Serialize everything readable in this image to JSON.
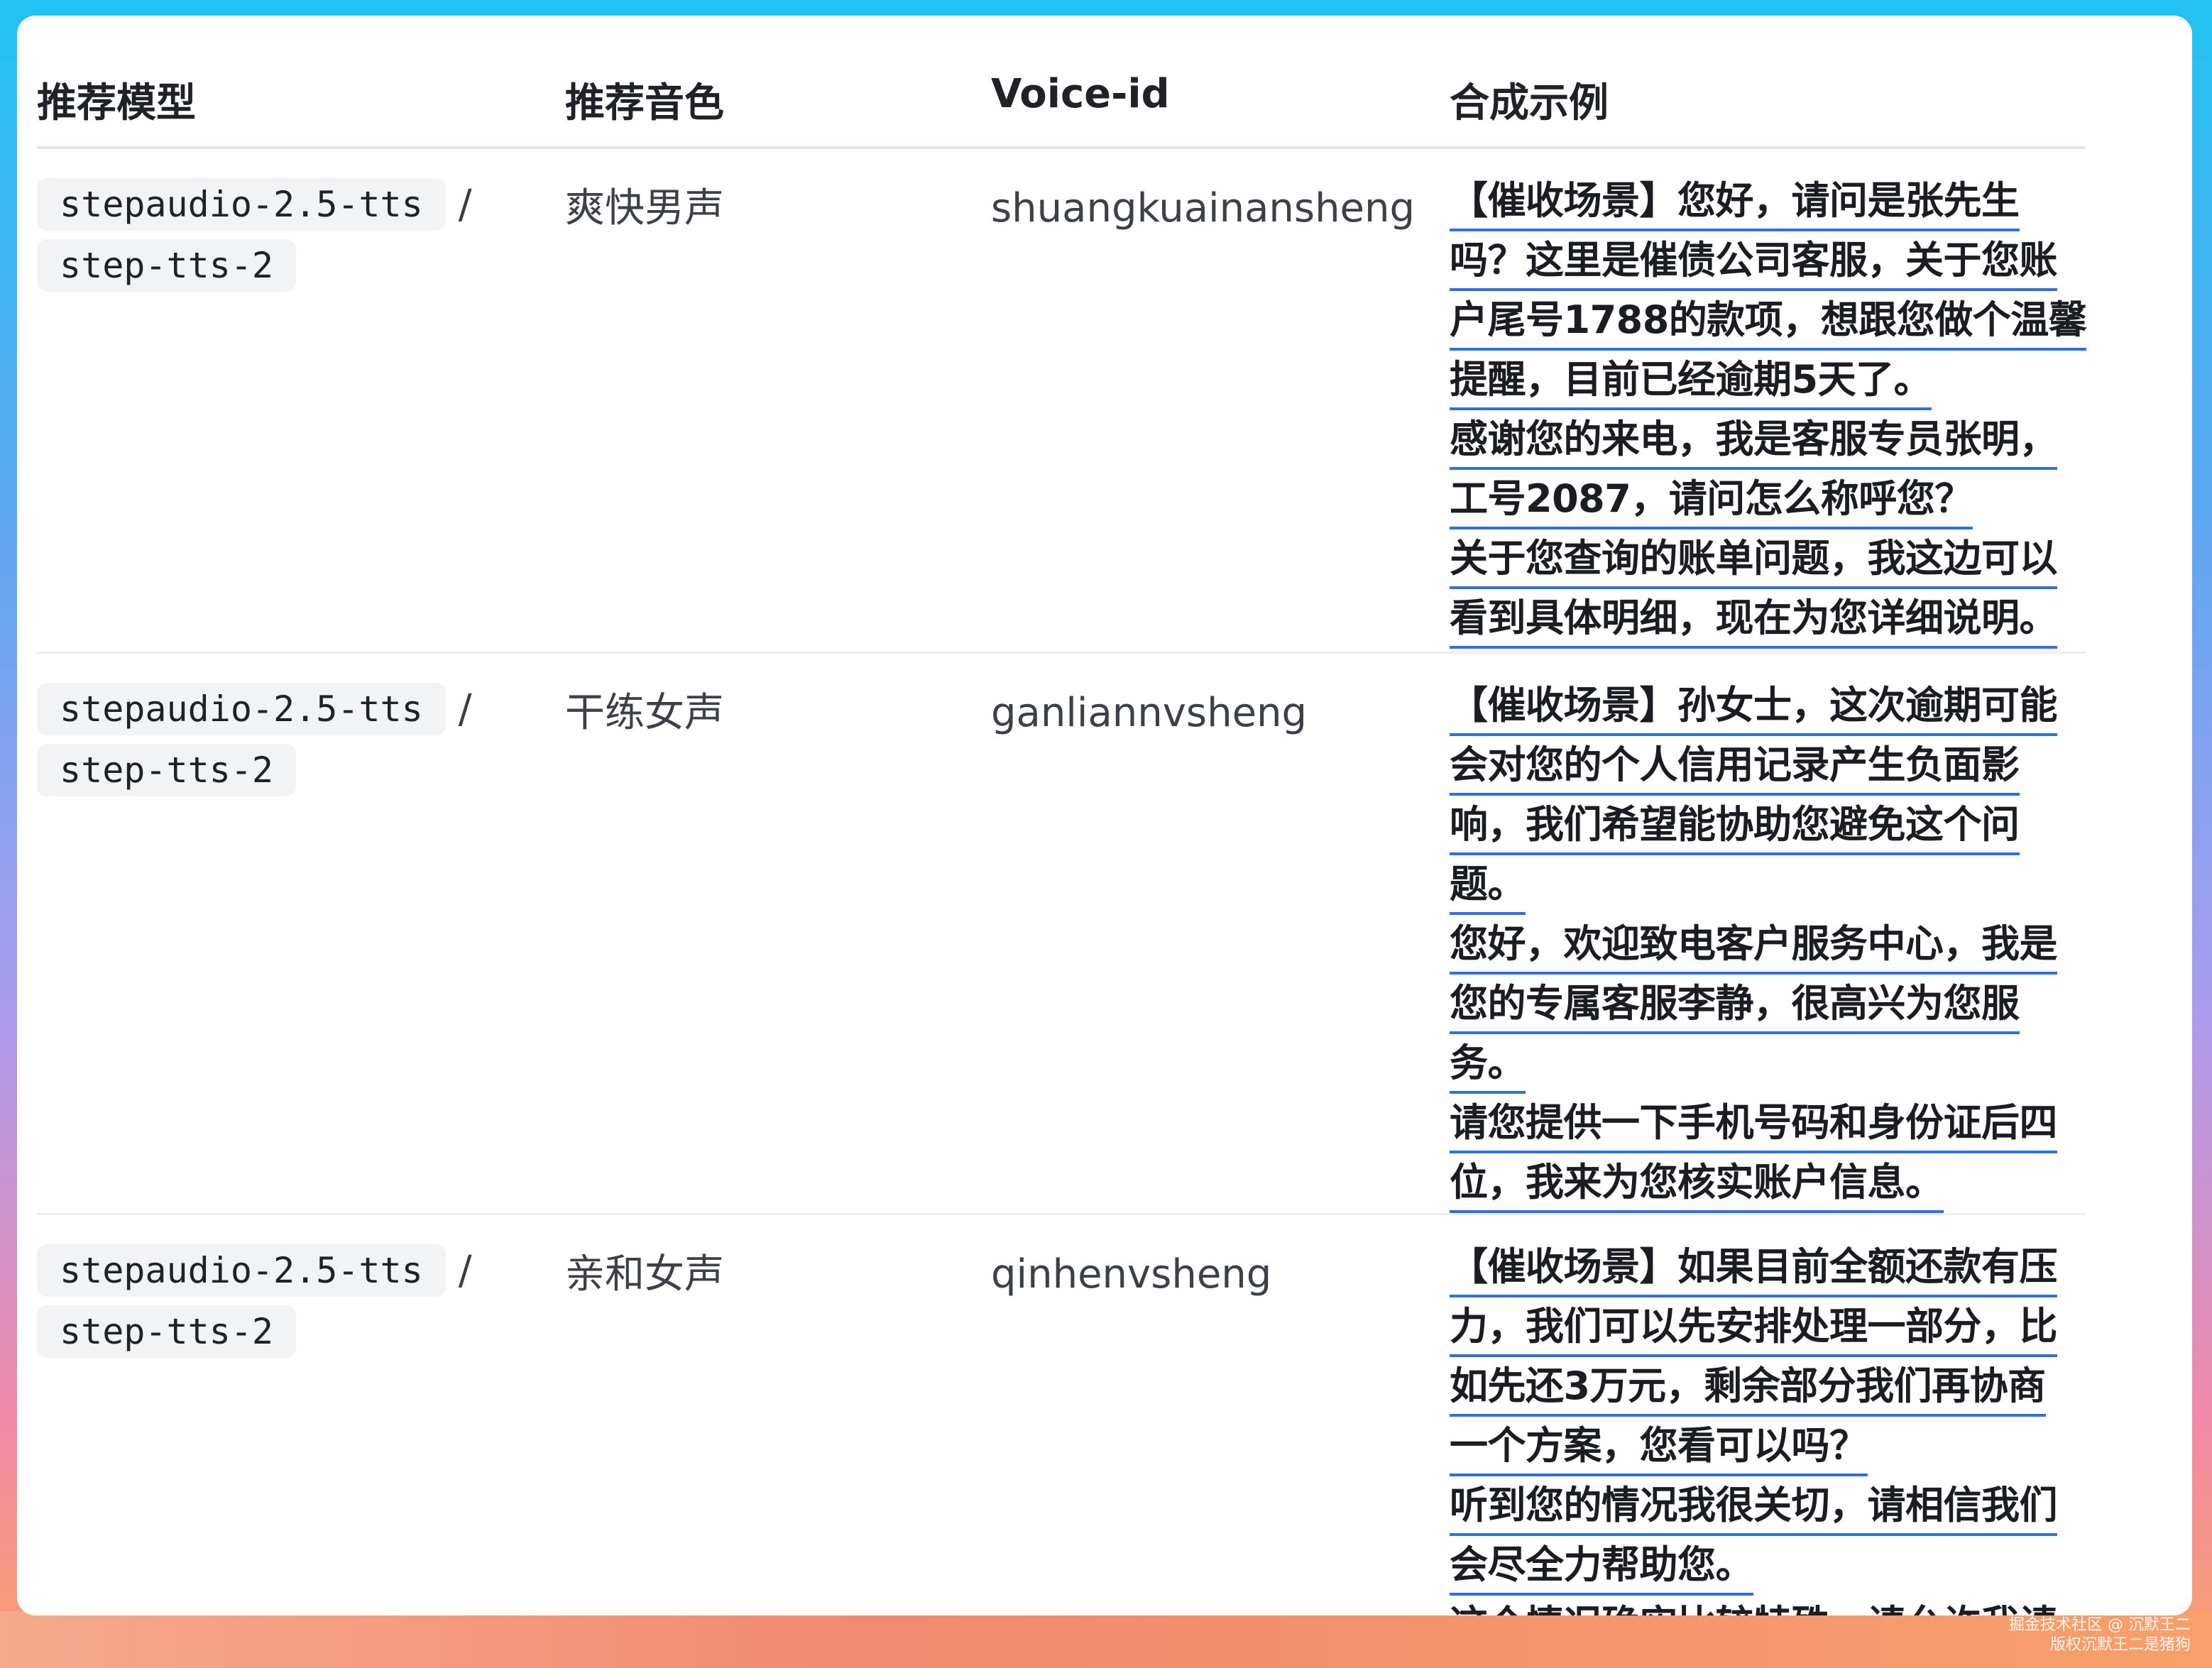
{
  "table": {
    "headers": {
      "model": "推荐模型",
      "voice": "推荐音色",
      "voice_id": "Voice-id",
      "example": "合成示例"
    },
    "rows": [
      {
        "model_primary": "stepaudio-2.5-tts",
        "separator": "/",
        "model_secondary": "step-tts-2",
        "voice": "爽快男声",
        "voice_id": "shuangkuainansheng",
        "example_lines": [
          "【催收场景】您好，请问是张先生",
          "吗？这里是催债公司客服，关于您账",
          "户尾号1788的款项，想跟您做个温馨",
          "提醒，目前已经逾期5天了。",
          "感谢您的来电，我是客服专员张明，",
          "工号2087，请问怎么称呼您？",
          "关于您查询的账单问题，我这边可以",
          "看到具体明细，现在为您详细说明。"
        ]
      },
      {
        "model_primary": "stepaudio-2.5-tts",
        "separator": "/",
        "model_secondary": "step-tts-2",
        "voice": "干练女声",
        "voice_id": "ganliannvsheng",
        "example_lines": [
          "【催收场景】孙女士，这次逾期可能",
          "会对您的个人信用记录产生负面影",
          "响，我们希望能协助您避免这个问",
          "题。",
          "您好，欢迎致电客户服务中心，我是",
          "您的专属客服李静，很高兴为您服",
          "务。",
          "请您提供一下手机号码和身份证后四",
          "位，我来为您核实账户信息。"
        ]
      },
      {
        "model_primary": "stepaudio-2.5-tts",
        "separator": "/",
        "model_secondary": "step-tts-2",
        "voice": "亲和女声",
        "voice_id": "qinhenvsheng",
        "example_lines": [
          "【催收场景】如果目前全额还款有压",
          "力，我们可以先安排处理一部分，比",
          "如先还3万元，剩余部分我们再协商",
          "一个方案，您看可以吗？",
          "听到您的情况我很关切，请相信我们",
          "会尽全力帮助您。",
          "这个情况确实比较特殊，请允许我请"
        ]
      }
    ]
  },
  "watermark": {
    "line1": "掘金技术社区 @ 沉默王二",
    "line2": "版权沉默王二是猪狗"
  }
}
